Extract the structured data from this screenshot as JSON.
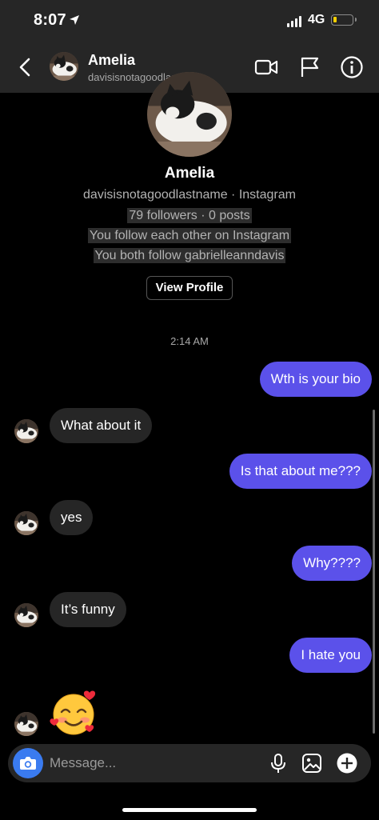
{
  "status_bar": {
    "time": "8:07",
    "network": "4G"
  },
  "header": {
    "name": "Amelia",
    "username": "davisisnotagoodlastname"
  },
  "profile": {
    "name": "Amelia",
    "source_line": "davisisnotagoodlastname · Instagram",
    "stats_line": "79 followers · 0 posts",
    "follow_line": "You follow each other on Instagram",
    "mutual_line": "You both follow gabrielleanndavis",
    "view_profile_label": "View Profile"
  },
  "timestamp": "2:14 AM",
  "messages": [
    {
      "from": "me",
      "text": "Wth is your bio"
    },
    {
      "from": "them",
      "text": "What about it"
    },
    {
      "from": "me",
      "text": "Is that about me???"
    },
    {
      "from": "them",
      "text": "yes"
    },
    {
      "from": "me",
      "text": "Why????"
    },
    {
      "from": "them",
      "text": "It’s funny"
    },
    {
      "from": "me",
      "text": "I hate you"
    },
    {
      "from": "them",
      "text": "",
      "emoji": "smiling-face-with-hearts"
    }
  ],
  "composer": {
    "placeholder": "Message..."
  },
  "colors": {
    "sent_bubble": "#5b51ea",
    "received_bubble": "#262626",
    "camera_button": "#3a7bf0",
    "header_bg": "#262626"
  }
}
